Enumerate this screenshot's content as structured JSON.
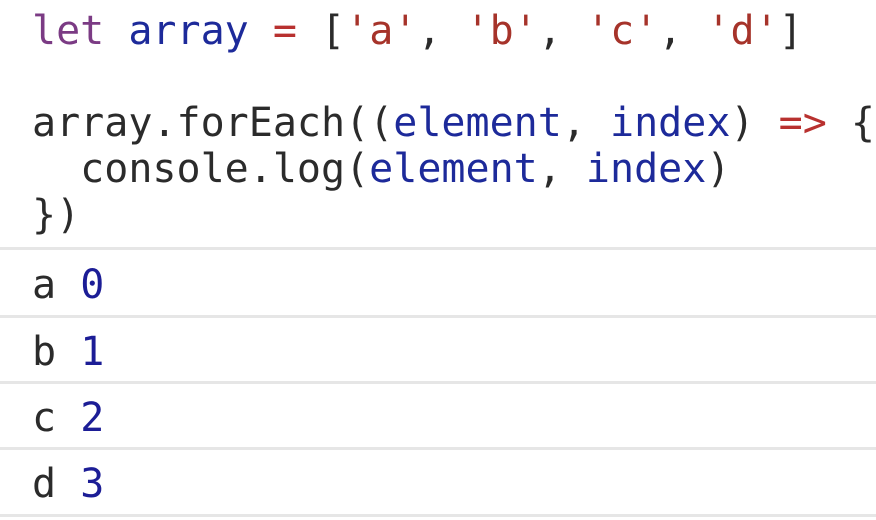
{
  "code": {
    "line1": {
      "kw_let": "let",
      "var_array": "array",
      "op_eq": "=",
      "open_bracket": "[",
      "str_a": "'a'",
      "comma1": ",",
      "str_b": "'b'",
      "comma2": ",",
      "str_c": "'c'",
      "comma3": ",",
      "str_d": "'d'",
      "close_bracket": "]"
    },
    "line2": {
      "object": "array.forEach((",
      "param1": "element",
      "comma": ",",
      "param2": "index",
      "close_paren": ")",
      "arrow": "=>",
      "open_brace": "{"
    },
    "line3": {
      "call": "console.log(",
      "arg1": "element",
      "comma": ",",
      "arg2": "index",
      "close_paren": ")"
    },
    "line4": {
      "close": "})"
    }
  },
  "output": [
    {
      "label": "a",
      "value": "0"
    },
    {
      "label": "b",
      "value": "1"
    },
    {
      "label": "c",
      "value": "2"
    },
    {
      "label": "d",
      "value": "3"
    }
  ]
}
